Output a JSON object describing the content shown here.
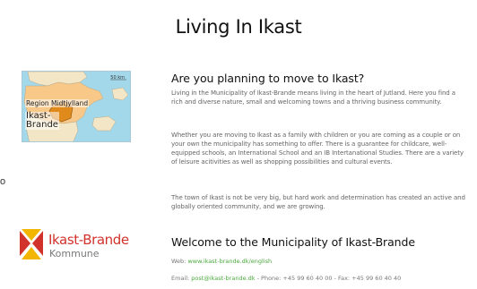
{
  "page": {
    "title": "Living In Ikast"
  },
  "map": {
    "scale_label": "50 km",
    "region_label": "Region Midtjylland",
    "city_label": "Ikast-\nBrande",
    "colors": {
      "sea": "#a3d8ea",
      "land": "#f3e6c6",
      "region": "#f7c887",
      "municipality": "#e08a1c"
    }
  },
  "stray_char": "o",
  "logo": {
    "name": "Ikast-Brande",
    "sub": "Kommune",
    "colors": {
      "red": "#d2322c",
      "gold": "#f2b600"
    }
  },
  "section1": {
    "heading": "Are you planning to move to Ikast?",
    "paragraphs": [
      "Living in the Municipality of Ikast-Brande means living in the heart of Jutland. Here you find a rich and diverse nature, small and welcoming towns and a thriving business community.",
      "Whether you are moving to Ikast as a family with children or you are coming as a couple or on your own the municipality has something to offer. There is a guarantee for childcare, well-equipped schools, an International School and an IB Intertanational Studies. There are a variety of leisure acitivities as well as shopping possibilities and cultural events.",
      "The town of Ikast is not be very big, but hard work and determination has created an active and globally oriented community, and we are growing."
    ]
  },
  "section2": {
    "heading": "Welcome to the Municipality of Ikast-Brande",
    "web_label": "Web: ",
    "web_link": "www.ikast-brande.dk/english",
    "email_label": "Email: ",
    "email_link": "post@ikast-brande.dk",
    "phone_fax": " - Phone: +45 99 60 40 00 - Fax: +45 99 60 40 40"
  }
}
